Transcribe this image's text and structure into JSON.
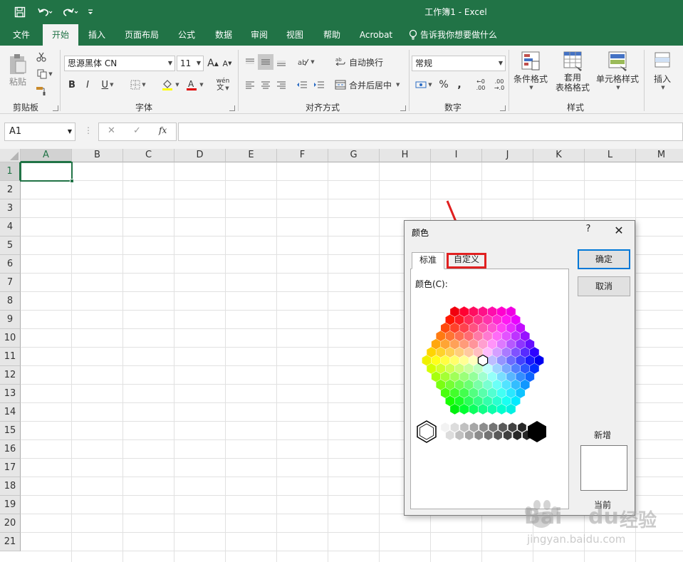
{
  "window": {
    "title": "工作簿1  -  Excel"
  },
  "quick_access": {
    "save_icon": "save-icon",
    "undo_icon": "undo-icon",
    "redo_icon": "redo-icon",
    "customize_icon": "chevron-down-icon"
  },
  "ribbon_tabs": [
    "文件",
    "开始",
    "插入",
    "页面布局",
    "公式",
    "数据",
    "审阅",
    "视图",
    "帮助",
    "Acrobat"
  ],
  "tell_me": "告诉我你想要做什么",
  "clipboard": {
    "paste_label": "粘贴",
    "group_label": "剪贴板"
  },
  "font": {
    "font_name": "思源黑体 CN",
    "font_size": "11",
    "bold": "B",
    "italic": "I",
    "underline": "U",
    "increase": "A",
    "decrease": "A",
    "group_label": "字体",
    "wen": "wén"
  },
  "alignment": {
    "wrap_text": "自动换行",
    "merge_center": "合并后居中",
    "group_label": "对齐方式"
  },
  "number": {
    "format": "常规",
    "percent": "%",
    "comma": ",",
    "group_label": "数字"
  },
  "styles": {
    "conditional_format": "条件格式",
    "format_table_line1": "套用",
    "format_table_line2": "表格格式",
    "cell_styles": "单元格样式",
    "group_label": "样式"
  },
  "cells": {
    "insert": "插入"
  },
  "formula_bar": {
    "name_box": "A1",
    "cancel": "✕",
    "enter": "✓",
    "fx": "fx",
    "formula": ""
  },
  "grid": {
    "columns": [
      "A",
      "B",
      "C",
      "D",
      "E",
      "F",
      "G",
      "H",
      "I",
      "J",
      "K",
      "L",
      "M"
    ],
    "rows": [
      "1",
      "2",
      "3",
      "4",
      "5",
      "6",
      "7",
      "8",
      "9",
      "10",
      "11",
      "12",
      "13",
      "14",
      "15",
      "16",
      "17",
      "18",
      "19",
      "20",
      "21"
    ],
    "active_cell": "A1"
  },
  "dialog": {
    "title": "颜色",
    "help": "?",
    "close": "✕",
    "tab_standard": "标准",
    "tab_custom": "自定义",
    "colors_label": "颜色(C):",
    "ok": "确定",
    "cancel": "取消",
    "new_label": "新增",
    "current_label": "当前",
    "new_color": "#ffffff"
  },
  "colors": {
    "excel_green": "#217346",
    "highlight_red": "#e02020"
  },
  "watermark": {
    "brand": "Bai",
    "brand2": "du",
    "cn": "经验",
    "url": "jingyan.baidu.com"
  }
}
